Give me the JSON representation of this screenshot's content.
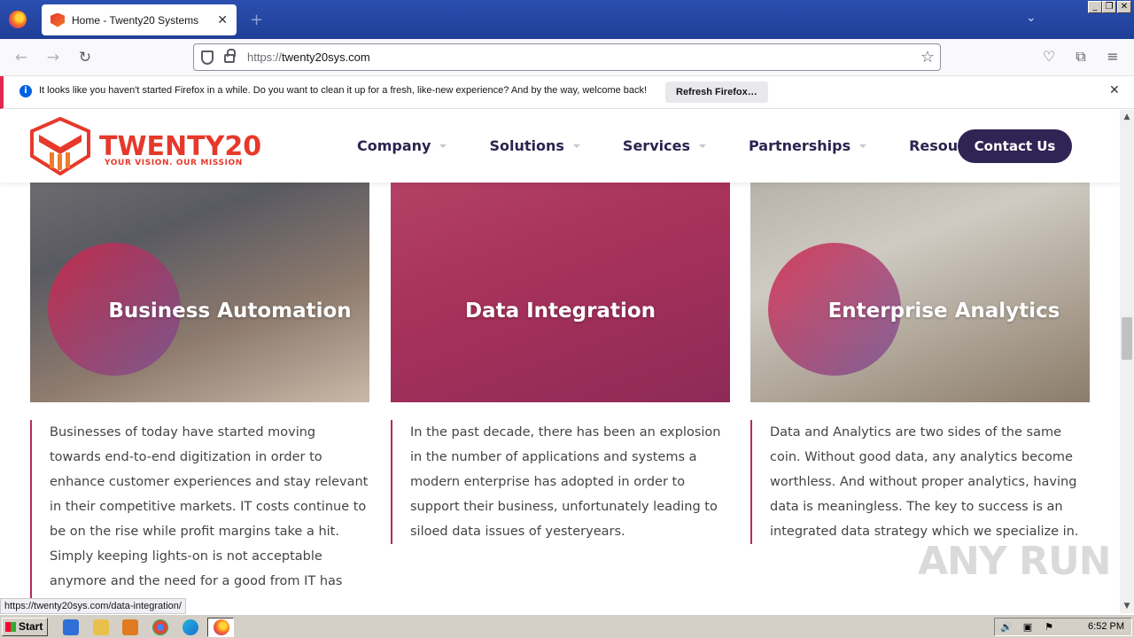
{
  "browser": {
    "tab_title": "Home - Twenty20 Systems",
    "url_protocol": "https://",
    "url_host": "twenty20sys.com",
    "notification_text": "It looks like you haven't started Firefox in a while. Do you want to clean it up for a fresh, like-new experience? And by the way, welcome back!",
    "notification_button": "Refresh Firefox…",
    "status_link": "https://twenty20sys.com/data-integration/"
  },
  "site": {
    "logo_name": "TWENTY20",
    "logo_tagline": "YOUR VISION. OUR MISSION",
    "menu": [
      {
        "label": "Company"
      },
      {
        "label": "Solutions"
      },
      {
        "label": "Services"
      },
      {
        "label": "Partnerships"
      },
      {
        "label": "Resources"
      }
    ],
    "contact_label": "Contact Us",
    "cards": [
      {
        "title": "Business Automation",
        "text": "Businesses of today have started moving towards end-to-end digitization in order to enhance customer experiences and stay relevant in their competitive markets. IT costs continue to be on the rise while profit margins take a hit. Simply keeping lights-on is not acceptable anymore and the need for a good from IT has never been"
      },
      {
        "title": "Data Integration",
        "text": "In the past decade, there has been an explosion in the number of applications and systems a modern enterprise has adopted in order to support their business, unfortunately leading to siloed data issues of yesteryears."
      },
      {
        "title": "Enterprise Analytics",
        "text": "Data and Analytics are two sides of the same coin. Without good data, any analytics become worthless. And without proper analytics, having data is meaningless. The key to success is an integrated data strategy which we specialize in."
      }
    ],
    "watermark": "ANY RUN"
  },
  "taskbar": {
    "start_label": "Start",
    "clock": "6:52 PM"
  },
  "colors": {
    "brand_red": "#e6392b",
    "brand_navy": "#2f2454",
    "accent_border": "#b62a5c"
  }
}
